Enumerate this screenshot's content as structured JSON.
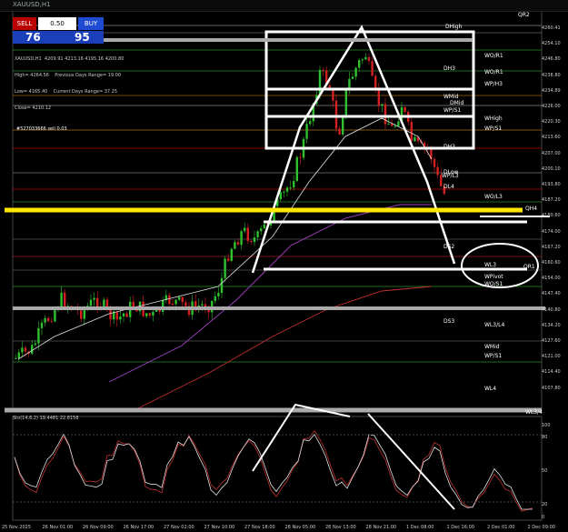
{
  "window": {
    "title": "XAUUSD,H1"
  },
  "trade_panel": {
    "sell_label": "SELL",
    "lot": "0.50",
    "buy_label": "BUY",
    "bid": "76",
    "ask": "95"
  },
  "info": {
    "ohlc": "XAUUSD,H1  4209.91 4213.16 4195.16 4200.80",
    "line1": "High= 4264.56    Previous Days Range= 19.00",
    "line2": "Low= 4165.40    Current Days Range= 37.25",
    "line3": "Close= 4210.12",
    "order": "#527033666 sell 0.03"
  },
  "levels": [
    "QR2",
    "DHigh",
    "WO/R1",
    "DH3",
    "WO/R1",
    "WMid",
    "WP/H3",
    "DMid",
    "WP/S1",
    "WHigh",
    "WP/S1",
    "DH3",
    "DLow",
    "WP/L3",
    "DL4",
    "WO/L3",
    "QH4",
    "DS2",
    "WL3",
    "QR1",
    "WPivot",
    "WO/S1",
    "DS3",
    "WL3/L4",
    "WMid",
    "WP/S1",
    "WL4",
    "WL3/4"
  ],
  "price_axis": [
    "4260.41",
    "4254.10",
    "4246.80",
    "4238.80",
    "4234.89",
    "4226.00",
    "4220.30",
    "4213.60",
    "4207.00",
    "4200.10",
    "4193.80",
    "4187.20",
    "4180.60",
    "4174.00",
    "4167.20",
    "4160.60",
    "4154.00",
    "4147.40",
    "4140.80",
    "4134.20",
    "4127.60",
    "4121.00",
    "4114.40",
    "4107.80"
  ],
  "stoch": {
    "title": "Sto(14,6,2) 19.4481 22.8158",
    "axis": [
      "100",
      "80",
      "50",
      "20",
      "0"
    ]
  },
  "dates": [
    "25 Nov 2025",
    "26 Nov 01:00",
    "26 Nov 09:00",
    "26 Nov 17:00",
    "27 Nov 02:00",
    "27 Nov 10:00",
    "27 Nov 18:00",
    "28 Nov 05:00",
    "28 Nov 13:00",
    "28 Nov 21:00",
    "1 Dec 08:00",
    "1 Dec 16:00",
    "2 Dec 01:00",
    "2 Dec 09:00"
  ],
  "colors": {
    "bull": "#2ec02e",
    "bear": "#d42020",
    "highlight": "#ffe600"
  }
}
